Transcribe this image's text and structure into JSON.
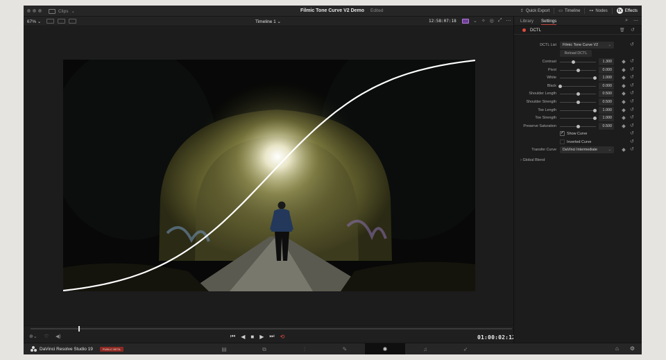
{
  "window": {
    "clips_label": "Clips",
    "project_title": "Filmic Tone Curve V2 Demo",
    "project_status": "Edited"
  },
  "top_right": {
    "quick_export": "Quick Export",
    "timeline": "Timeline",
    "nodes": "Nodes",
    "effects": "Effects"
  },
  "viewer": {
    "zoom": "67%",
    "timeline_name": "Timeline 1",
    "timecode": "12:58:07:18",
    "playhead_timecode": "01:00:02:12",
    "playhead_fraction": 0.1
  },
  "inspector": {
    "tabs": [
      "Library",
      "Settings"
    ],
    "active_tab": "Settings",
    "effect_name": "DCTL",
    "dctl_list_label": "DCTL List",
    "dctl_list_value": "Filmic Tone Curve V2",
    "reload_label": "Reload DCTL",
    "params": [
      {
        "label": "Contrast",
        "value": "1.300",
        "slider": 0.38
      },
      {
        "label": "Pivot",
        "value": "0.000",
        "slider": 0.5
      },
      {
        "label": "White",
        "value": "1.000",
        "slider": 0.97
      },
      {
        "label": "Black",
        "value": "0.000",
        "slider": 0.0
      },
      {
        "label": "Shoulder Length",
        "value": "0.500",
        "slider": 0.5
      },
      {
        "label": "Shoulder Strength",
        "value": "0.500",
        "slider": 0.5
      },
      {
        "label": "Toe Length",
        "value": "1.000",
        "slider": 0.97
      },
      {
        "label": "Toe Strength",
        "value": "1.000",
        "slider": 0.97
      },
      {
        "label": "Preserve Saturation",
        "value": "0.500",
        "slider": 0.5
      }
    ],
    "show_curve_label": "Show Curve",
    "show_curve_checked": true,
    "inverted_curve_label": "Inverted Curve",
    "inverted_curve_checked": false,
    "transfer_curve_label": "Transfer Curve",
    "transfer_curve_value": "DaVinci Intermediate",
    "global_blend_label": "Global Blend"
  },
  "footer": {
    "app_name": "DaVinci Resolve Studio 19",
    "badge": "PUBLIC BETA"
  },
  "colors": {
    "accent_red": "#e04a3d",
    "background": "#1f1f20"
  }
}
